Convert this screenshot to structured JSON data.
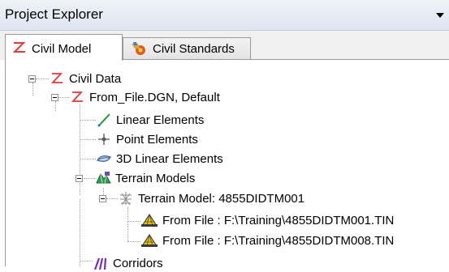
{
  "window": {
    "title": "Project Explorer",
    "menu_icon": "dropdown-arrow-icon"
  },
  "tabs": [
    {
      "label": "Civil Model",
      "icon": "civil-model-icon",
      "active": true
    },
    {
      "label": "Civil Standards",
      "icon": "civil-standards-icon",
      "active": false
    }
  ],
  "tree": {
    "civil_data": "Civil Data",
    "model": "From_File.DGN, Default",
    "linear_elements": "Linear Elements",
    "point_elements": "Point Elements",
    "linear_3d_elements": "3D Linear Elements",
    "terrain_models": "Terrain Models",
    "terrain_model": "Terrain Model: 4855DIDTM001",
    "file_1": "From File : F:\\Training\\4855DIDTM001.TIN",
    "file_2": "From File : F:\\Training\\4855DIDTM008.TIN",
    "corridors": "Corridors"
  },
  "colors": {
    "civil_red": "#e03a3a",
    "linear_green": "#1f9a3a",
    "tin_yellow": "#f0c400"
  }
}
